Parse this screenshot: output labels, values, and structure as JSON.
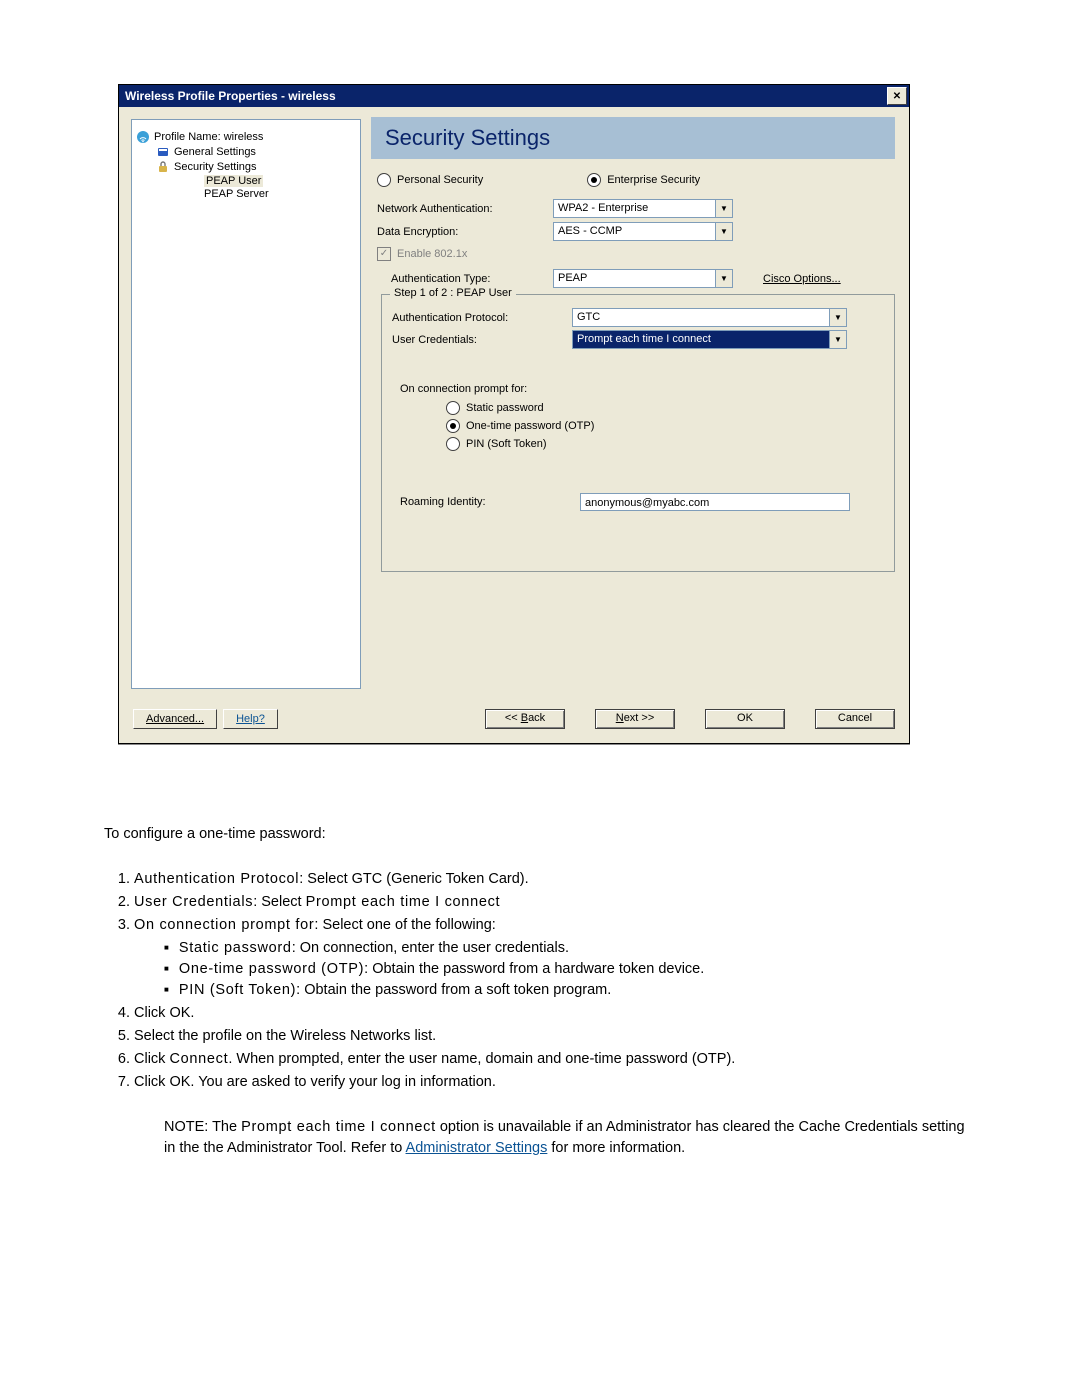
{
  "window": {
    "title": "Wireless Profile Properties - wireless",
    "close_symbol": "✕"
  },
  "tree": {
    "profile_label": "Profile Name: wireless",
    "general": "General Settings",
    "security": "Security Settings",
    "peap_user": "PEAP User",
    "peap_server": "PEAP Server"
  },
  "heading": "Security Settings",
  "security_type": {
    "personal": "Personal Security",
    "enterprise": "Enterprise Security"
  },
  "fields": {
    "net_auth_label": "Network Authentication:",
    "net_auth_value": "WPA2 - Enterprise",
    "data_enc_label": "Data Encryption:",
    "data_enc_value": "AES - CCMP",
    "enable_8021x": "Enable 802.1x",
    "auth_type_label": "Authentication Type:",
    "auth_type_value": "PEAP",
    "cisco_options": "Cisco Options..."
  },
  "step": {
    "legend": "Step 1 of 2 : PEAP User",
    "auth_proto_label": "Authentication Protocol:",
    "auth_proto_value": "GTC",
    "user_cred_label": "User Credentials:",
    "user_cred_value": "Prompt each time I connect",
    "prompt_for_label": "On connection prompt for:",
    "opt_static": "Static password",
    "opt_otp": "One-time password (OTP)",
    "opt_pin": "PIN (Soft Token)",
    "roaming_label": "Roaming Identity:",
    "roaming_value": "anonymous@myabc.com"
  },
  "buttons": {
    "advanced": "Advanced...",
    "help": "Help?",
    "back": "<< Back",
    "next": "Next >>",
    "ok": "OK",
    "cancel": "Cancel"
  },
  "doc": {
    "intro": "To configure a one-time password:",
    "steps": {
      "s1_prefix": "Authentication Protocol",
      "s1_rest": ": Select GTC (Generic Token Card).",
      "s2_prefix": "User Credentials",
      "s2_rest": ": Select ",
      "s2_bold": "Prompt each time I connect",
      "s3_prefix": "On connection prompt for",
      "s3_rest": ": Select one of the following:",
      "b1_prefix": "Static password",
      "b1_rest": ": On connection, enter the user credentials.",
      "b2_prefix": "One-time password (OTP)",
      "b2_rest": ": Obtain the password from a hardware token device.",
      "b3_prefix": "PIN (Soft Token)",
      "b3_rest": ": Obtain the password from a soft token program.",
      "s4": "Click OK.",
      "s5": "Select the profile on the Wireless Networks list.",
      "s6_a": "Click ",
      "s6_bold": "Connect",
      "s6_b": ". When prompted, enter the user name, domain and one-time password (OTP).",
      "s7": "Click OK. You are asked to verify your log in information."
    },
    "note_a": "NOTE: The ",
    "note_bold": "Prompt each time I connect",
    "note_b": " option is unavailable if an Administrator has cleared the Cache Credentials setting in the the Administrator Tool. Refer to ",
    "note_link": "Administrator Settings",
    "note_c": " for more information."
  }
}
